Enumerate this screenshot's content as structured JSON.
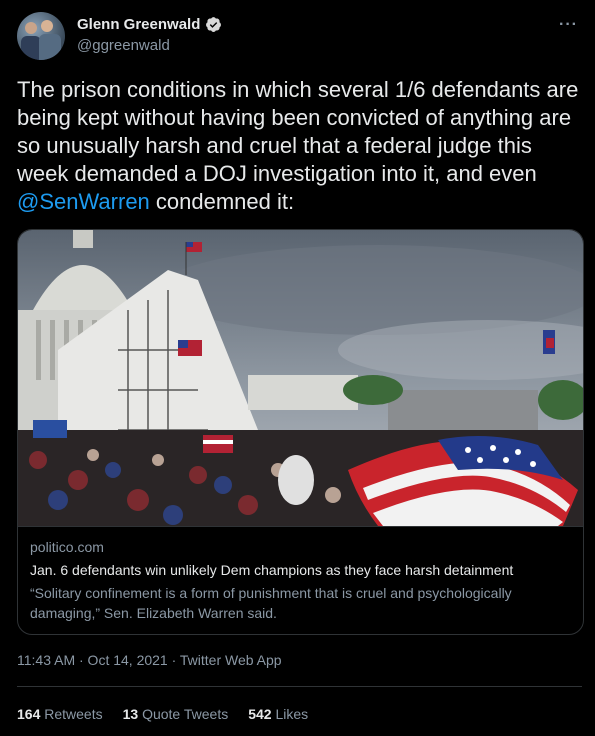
{
  "author": {
    "name": "Glenn Greenwald",
    "handle": "@ggreenwald",
    "verified_icon": "verified-badge-icon",
    "more_icon": "more-options-icon"
  },
  "tweet": {
    "text_before": "The prison conditions in which several 1/6 defendants are being kept without having been convicted of anything are so unusually harsh and cruel that a federal judge this week demanded a DOJ investigation into it, and even ",
    "mention": "@SenWarren",
    "text_after": " condemned it:"
  },
  "card": {
    "domain": "politico.com",
    "title": "Jan. 6 defendants win unlikely Dem champions as they face harsh detainment",
    "description": "“Solitary confinement is a form of punishment that is cruel and psychologically damaging,” Sen. Elizabeth Warren said."
  },
  "meta": {
    "timestamp": "11:43 AM · Oct 14, 2021 · Twitter Web App"
  },
  "stats": {
    "retweets_count": "164",
    "retweets_label": "Retweets",
    "quotes_count": "13",
    "quotes_label": "Quote Tweets",
    "likes_count": "542",
    "likes_label": "Likes"
  },
  "colors": {
    "background": "#000000",
    "text": "#e7e9ea",
    "secondary": "#8b98a5",
    "accent": "#1d9bf0",
    "border": "#2f3336"
  }
}
